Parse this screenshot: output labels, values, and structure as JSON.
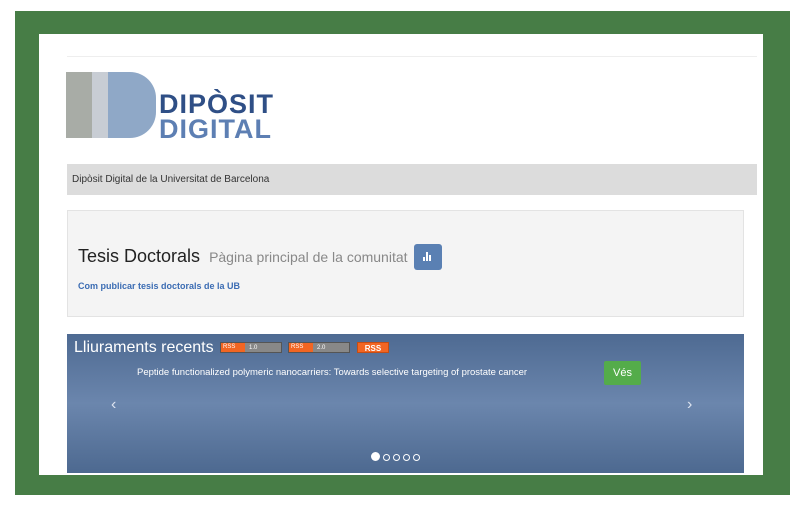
{
  "logo": {
    "line1": "DIPÒSIT",
    "line2": "DIGITAL"
  },
  "breadcrumb": "Dipòsit Digital de la Universitat de Barcelona",
  "community": {
    "title": "Tesis Doctorals",
    "subtitle": "Pàgina principal de la comunitat",
    "link": "Com publicar tesis doctorals de la UB"
  },
  "recent": {
    "heading": "Lliuraments recents",
    "rss_badges": [
      {
        "left": "RSS",
        "right": "1.0"
      },
      {
        "left": "RSS",
        "right": "2.0"
      }
    ],
    "rss_label": "RSS",
    "item_title": "Peptide functionalized polymeric nanocarriers: Towards selective targeting of prostate cancer",
    "go_label": "Vés",
    "prev": "‹",
    "next": "›",
    "slide_count": 5,
    "active_slide": 1
  },
  "colors": {
    "frame": "#477d46",
    "accent": "#2f4f86",
    "go_button": "#54ac4a",
    "rss": "#f26522"
  }
}
